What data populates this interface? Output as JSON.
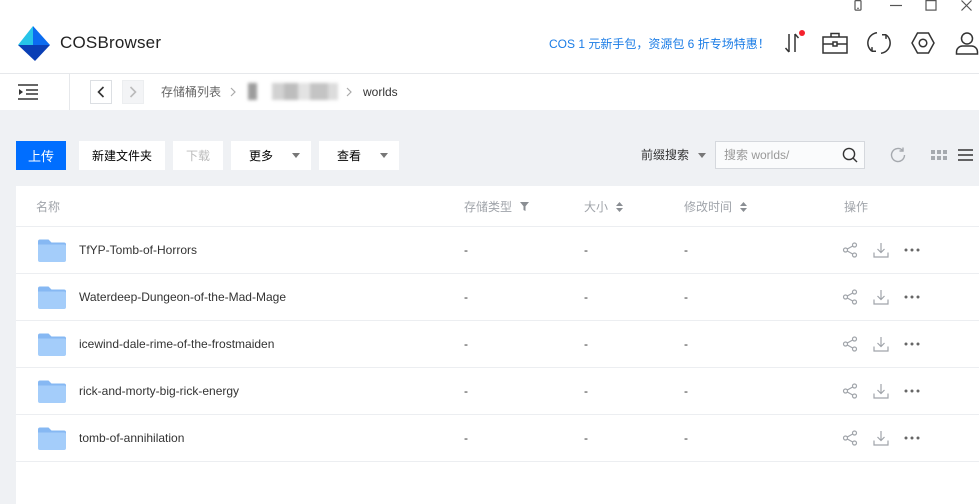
{
  "window": {
    "controls": [
      "phone-icon",
      "minimize-icon",
      "maximize-icon",
      "close-icon"
    ]
  },
  "app": {
    "title": "COSBrowser"
  },
  "header": {
    "promo": "COS 1 元新手包，资源包 6 折专场特惠！",
    "icons": [
      "transfer-list-icon",
      "toolbox-icon",
      "sync-icon",
      "settings-icon",
      "user-icon"
    ],
    "transfer_has_notification": true
  },
  "breadcrumb": {
    "root": "存储桶列表",
    "current": "worlds"
  },
  "toolbar": {
    "upload": "上传",
    "new_folder": "新建文件夹",
    "download": "下载",
    "more": "更多",
    "view": "查看",
    "search_mode": "前缀搜索",
    "search_placeholder": "搜索 worlds/",
    "right_icons": [
      "refresh-icon",
      "grid-view-icon",
      "list-view-icon"
    ]
  },
  "table": {
    "columns": {
      "name": "名称",
      "storage_class": "存储类型",
      "size": "大小",
      "modified": "修改时间",
      "actions": "操作"
    },
    "row_icon": "folder-icon",
    "row_actions": [
      "share-icon",
      "download-icon",
      "more-icon"
    ],
    "rows": [
      {
        "name": "TfYP-Tomb-of-Horrors",
        "storage_class": "-",
        "size": "-",
        "modified": "-"
      },
      {
        "name": "Waterdeep-Dungeon-of-the-Mad-Mage",
        "storage_class": "-",
        "size": "-",
        "modified": "-"
      },
      {
        "name": "icewind-dale-rime-of-the-frostmaiden",
        "storage_class": "-",
        "size": "-",
        "modified": "-"
      },
      {
        "name": "rick-and-morty-big-rick-energy",
        "storage_class": "-",
        "size": "-",
        "modified": "-"
      },
      {
        "name": "tomb-of-annihilation",
        "storage_class": "-",
        "size": "-",
        "modified": "-"
      }
    ]
  },
  "colors": {
    "accent": "#006eff",
    "promo": "#1a7ce6",
    "page_bg": "#eff1f4",
    "notification_dot": "#f5222d",
    "folder": "#a4cdfa",
    "folder_tab": "#86b8f3"
  }
}
